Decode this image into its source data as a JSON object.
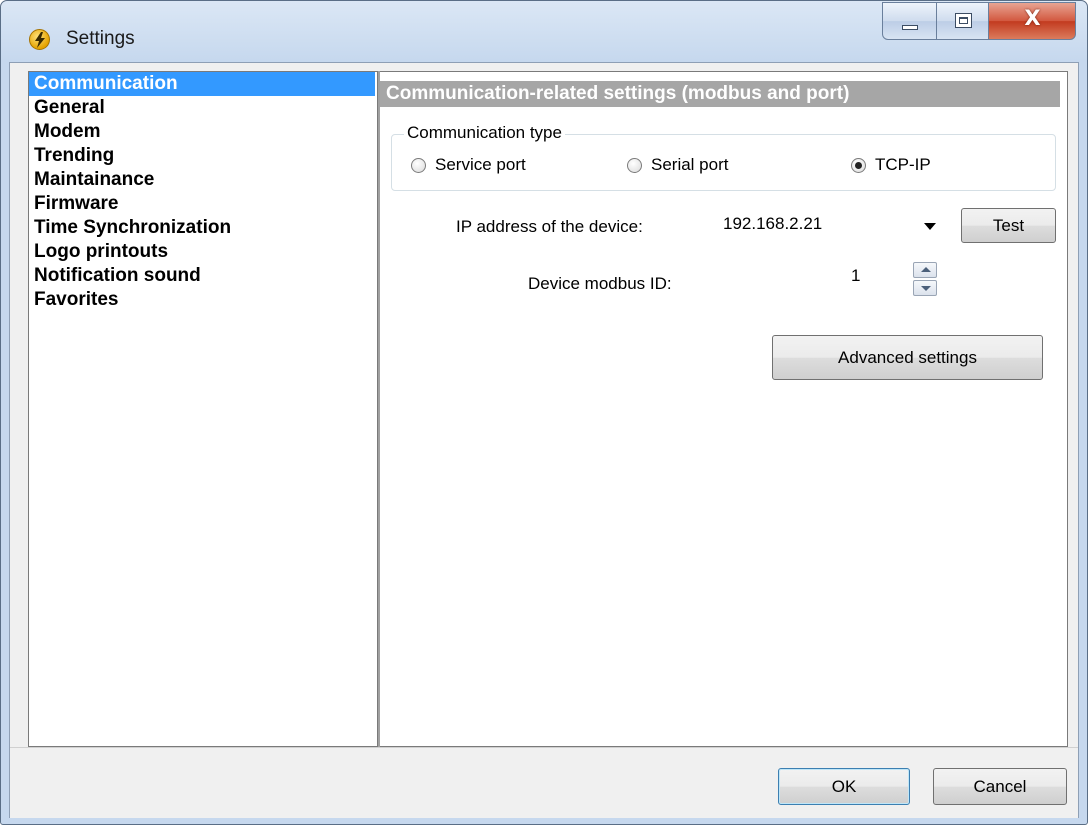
{
  "window": {
    "title": "Settings",
    "close_glyph": "X"
  },
  "sidebar": {
    "items": [
      {
        "label": "Communication",
        "selected": true
      },
      {
        "label": "General"
      },
      {
        "label": "Modem"
      },
      {
        "label": "Trending"
      },
      {
        "label": "Maintainance"
      },
      {
        "label": "Firmware"
      },
      {
        "label": "Time Synchronization"
      },
      {
        "label": "Logo printouts"
      },
      {
        "label": "Notification sound"
      },
      {
        "label": "Favorites"
      }
    ]
  },
  "panel": {
    "header": "Communication-related settings (modbus and port)",
    "communication_type": {
      "legend": "Communication type",
      "options": [
        {
          "label": "Service port",
          "checked": false
        },
        {
          "label": "Serial port",
          "checked": false
        },
        {
          "label": "TCP-IP",
          "checked": true
        }
      ]
    },
    "ip_address": {
      "label": "IP address of the device:",
      "value": "192.168.2.21"
    },
    "test_button": "Test",
    "modbus_id": {
      "label": "Device modbus ID:",
      "value": "1"
    },
    "advanced_button": "Advanced settings"
  },
  "footer": {
    "ok_label": "OK",
    "cancel_label": "Cancel"
  },
  "icons": {
    "app": "lightning-bolt-icon",
    "minimize": "minimize-icon",
    "maximize": "maximize-icon",
    "close": "close-icon",
    "dropdown": "chevron-down-icon",
    "spin_up": "arrow-up-icon",
    "spin_down": "arrow-down-icon"
  },
  "colors": {
    "selection": "#3399ff",
    "section_header": "#a6a6a6",
    "close_button": "#c94a30"
  }
}
